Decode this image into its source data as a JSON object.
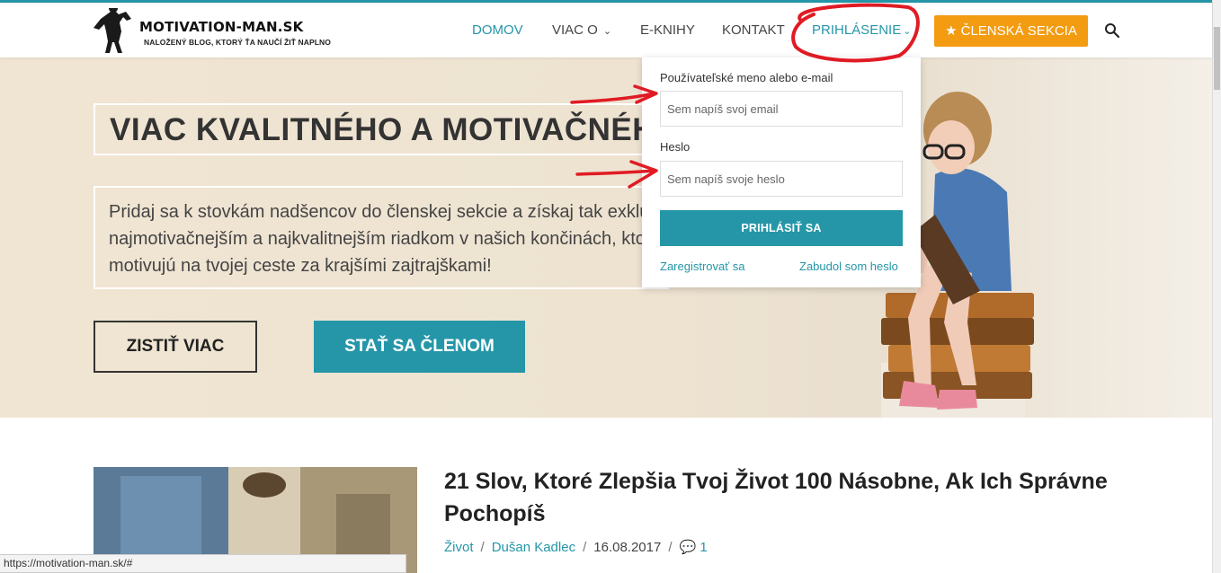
{
  "colors": {
    "accent": "#2596a8",
    "orange": "#f39c12",
    "annotation_red": "#e01b24"
  },
  "logo": {
    "name": "MOTIVATION-MAN.SK",
    "tagline": "NALOŽENÝ BLOG, KTORÝ ŤA NAUČÍ ŽIŤ NAPLNO"
  },
  "nav": {
    "items": [
      {
        "label": "DOMOV",
        "active": true
      },
      {
        "label": "VIAC O",
        "has_dropdown": true
      },
      {
        "label": "E-KNIHY"
      },
      {
        "label": "KONTAKT"
      },
      {
        "label": "PRIHLÁSENIE",
        "has_dropdown": true,
        "active": true
      }
    ],
    "member_button": "ČLENSKÁ SEKCIA",
    "member_icon": "star-icon",
    "search_icon": "search-icon"
  },
  "hero": {
    "title": "VIAC KVALITNÉHO A MOTIVAČNÉHO",
    "text": "Pridaj sa k stovkám nadšencov do členskej sekcie a získaj tak exkluzí najmotivačnejším a najkvalitnejším riadkom v našich končinách, ktore a motivujú na tvojej ceste za krajšími zajtrajškami!",
    "btn_more": "ZISTIŤ VIAC",
    "btn_join": "STAŤ SA ČLENOM"
  },
  "login": {
    "user_label": "Používateľské meno alebo e-mail",
    "user_placeholder": "Sem napíš svoj email",
    "pass_label": "Heslo",
    "pass_placeholder": "Sem napíš svoje heslo",
    "submit": "PRIHLÁSIŤ SA",
    "register": "Zaregistrovať sa",
    "forgot": "Zabudol som heslo"
  },
  "post": {
    "title": "21 Slov, Ktoré Zlepšia Tvoj Život 100 Násobne, Ak Ich Správne Pochopíš",
    "category": "Život",
    "author": "Dušan Kadlec",
    "date": "16.08.2017",
    "comments": "1",
    "comment_icon": "comment-icon"
  },
  "status_bar": {
    "url": "https://motivation-man.sk/#"
  }
}
